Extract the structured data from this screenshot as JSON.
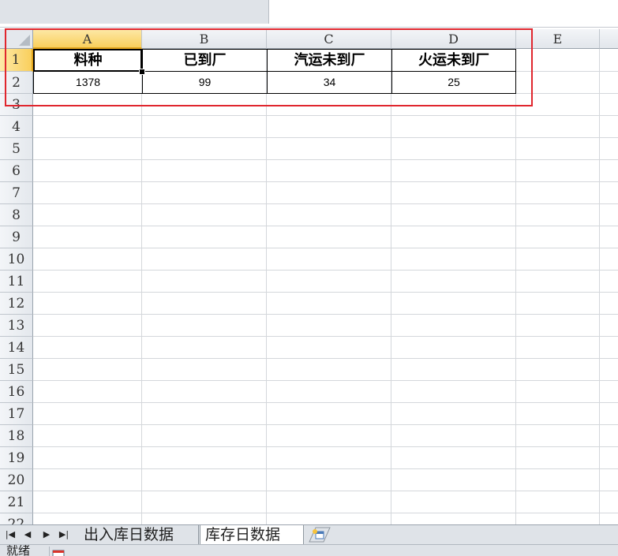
{
  "columns": [
    "A",
    "B",
    "C",
    "D",
    "E"
  ],
  "rows": [
    "1",
    "2",
    "3",
    "4",
    "5",
    "6",
    "7",
    "8",
    "9",
    "10",
    "11",
    "12",
    "13",
    "14",
    "15",
    "16",
    "17",
    "18",
    "19",
    "20",
    "21",
    "22"
  ],
  "table": {
    "headers": [
      "料种",
      "已到厂",
      "汽运未到厂",
      "火运未到厂"
    ],
    "values": [
      "1378",
      "99",
      "34",
      "25"
    ]
  },
  "sheet_tabs": {
    "tab1": "出入库日数据",
    "tab2": "库存日数据"
  },
  "status": {
    "ready_label": "就绪"
  },
  "colors": {
    "highlight_box": "#e0262e",
    "active_header": "#f9cf5c"
  },
  "icons": [
    "first-sheet-icon",
    "prev-sheet-icon",
    "next-sheet-icon",
    "last-sheet-icon",
    "insert-sheet-icon",
    "macro-record-icon"
  ]
}
